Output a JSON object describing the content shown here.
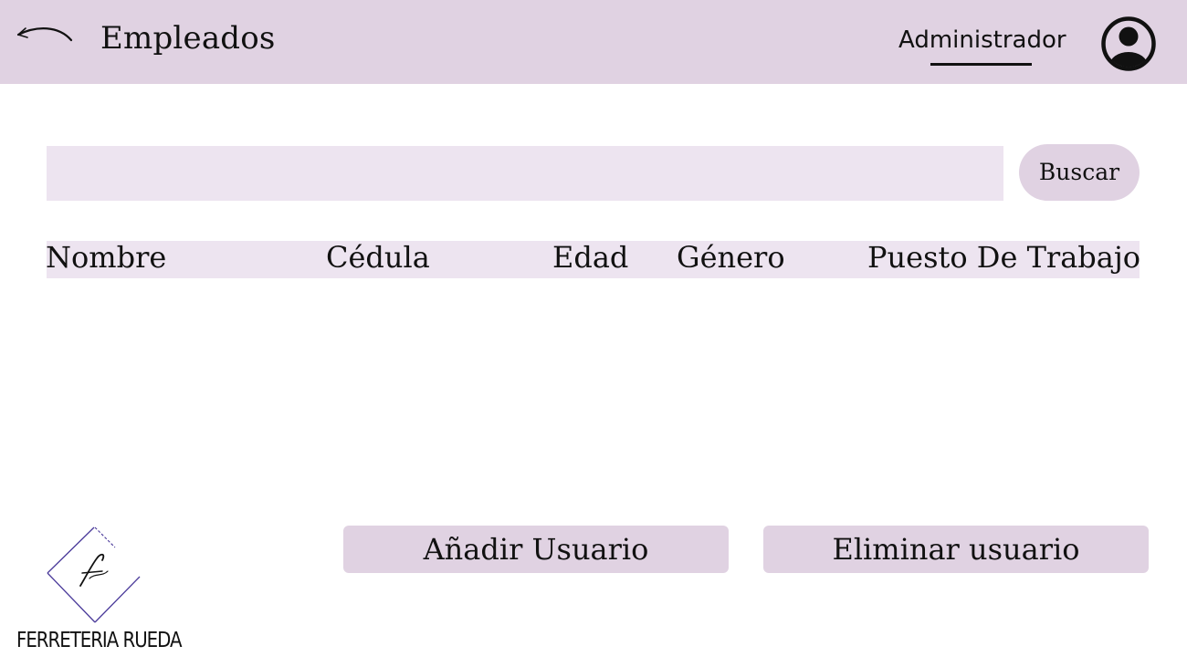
{
  "header": {
    "title": "Empleados",
    "role_tab": "Administrador",
    "back_icon": "back-arrow-icon",
    "avatar_icon": "user-avatar-icon"
  },
  "search": {
    "value": "",
    "placeholder": "",
    "button_label": "Buscar"
  },
  "table": {
    "columns": [
      "Nombre",
      "Cédula",
      "Edad",
      "Género",
      "Puesto De Trabajo"
    ],
    "rows": []
  },
  "actions": {
    "add_user": "Añadir Usuario",
    "delete_user": "Eliminar usuario"
  },
  "brand": {
    "logo_icon": "diamond-f-logo",
    "name": "FERRETERIA RUEDA"
  },
  "colors": {
    "header_bg": "#e0d2e2",
    "panel_bg": "#ede4f0",
    "button_bg": "#e0d2e2",
    "text": "#111111",
    "logo_accent": "#4a3a9a"
  }
}
